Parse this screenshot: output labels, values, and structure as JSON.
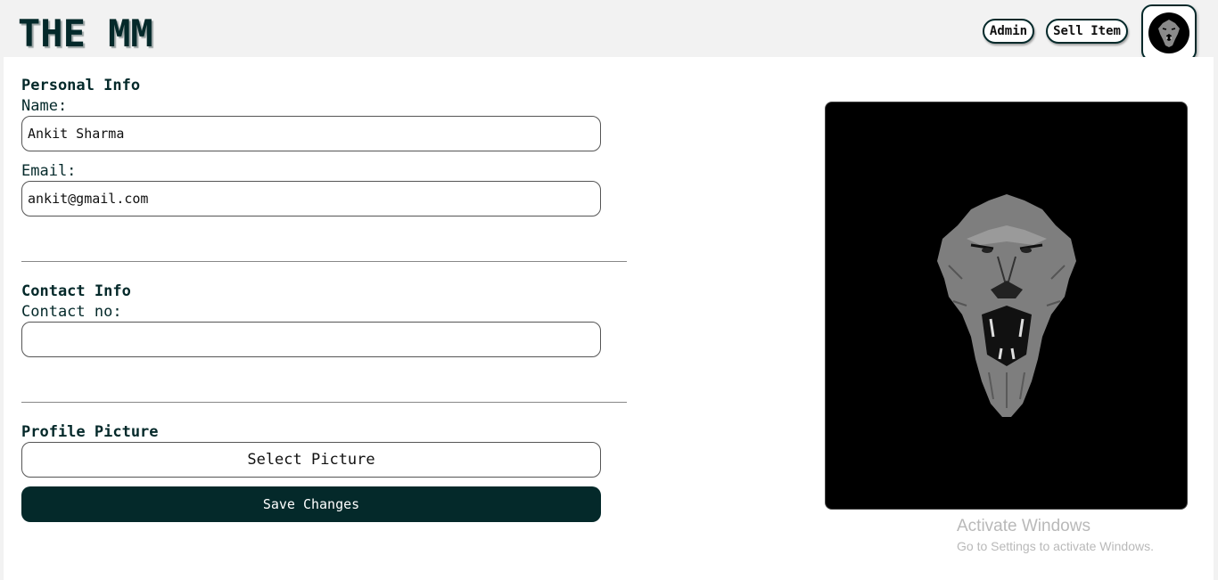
{
  "header": {
    "brand": "THE MM",
    "admin_label": "Admin",
    "sell_label": "Sell Item"
  },
  "personal": {
    "title": "Personal Info",
    "name_label": "Name:",
    "name_value": "Ankit Sharma",
    "email_label": "Email:",
    "email_value": "ankit@gmail.com"
  },
  "contact": {
    "title": "Contact Info",
    "phone_label": "Contact no:",
    "phone_value": ""
  },
  "picture": {
    "title": "Profile Picture",
    "select_label": "Select Picture",
    "save_label": "Save Changes"
  },
  "watermark": {
    "title": "Activate Windows",
    "subtitle": "Go to Settings to activate Windows."
  },
  "colors": {
    "brand": "#04292a",
    "page_background": "#f2f2f2",
    "preview_background": "#000000"
  },
  "icons": {
    "avatar": "lion-avatar-icon",
    "preview": "lion-face-illustration"
  }
}
